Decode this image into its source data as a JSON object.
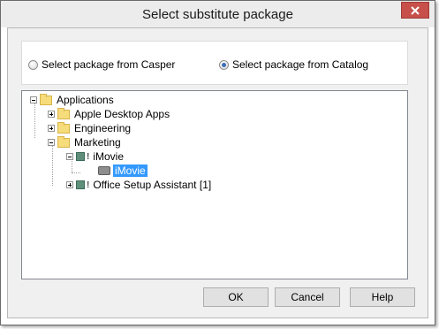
{
  "dialog": {
    "title": "Select substitute package",
    "close_label": "✕"
  },
  "source": {
    "options": [
      {
        "label": "Select package from Casper",
        "checked": false
      },
      {
        "label": "Select package from Catalog",
        "checked": true
      }
    ]
  },
  "tree": {
    "root": "Applications",
    "children": [
      "Apple Desktop Apps",
      "Engineering",
      "Marketing"
    ],
    "marketing_children": [
      "iMovie",
      "Office Setup Assistant [1]"
    ],
    "imovie_child": "iMovie",
    "badge": "!"
  },
  "buttons": {
    "ok": "OK",
    "cancel": "Cancel",
    "help": "Help"
  }
}
